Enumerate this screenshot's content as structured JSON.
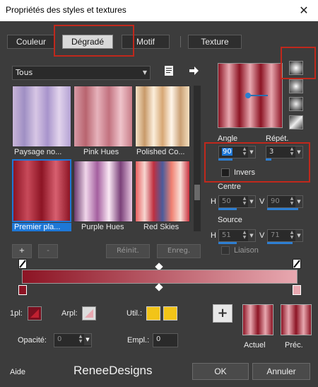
{
  "window": {
    "title": "Propriétés des styles et textures",
    "close_glyph": "✕"
  },
  "tabs": [
    {
      "label": "Couleur"
    },
    {
      "label": "Dégradé"
    },
    {
      "label": "Motif"
    },
    {
      "label": "Texture"
    }
  ],
  "category": {
    "value": "Tous"
  },
  "gradients": [
    {
      "label": "Paysage no...",
      "selected": false
    },
    {
      "label": "Pink Hues",
      "selected": false
    },
    {
      "label": "Polished Co...",
      "selected": false
    },
    {
      "label": "Premier pla...",
      "selected": true
    },
    {
      "label": "Purple Hues",
      "selected": false
    },
    {
      "label": "Red Skies",
      "selected": false
    }
  ],
  "list_buttons": {
    "add": "+",
    "remove": "-",
    "reset": "Réinit.",
    "save": "Enreg."
  },
  "angle": {
    "label": "Angle",
    "value": "90"
  },
  "repeat": {
    "label": "Répét.",
    "value": "3"
  },
  "invert": {
    "label": "Invers",
    "checked": false
  },
  "center": {
    "label": "Centre",
    "h_label": "H",
    "h_value": "50",
    "v_label": "V",
    "v_value": "90"
  },
  "source": {
    "label": "Source",
    "h_label": "H",
    "h_value": "51",
    "v_label": "V",
    "v_value": "71"
  },
  "link": {
    "label": "Liaison",
    "checked": false
  },
  "bottom": {
    "fg_label": "1pl:",
    "bg_label": "Arpl:",
    "util_label": "Util.:",
    "opacity_label": "Opacité:",
    "opacity_value": "0",
    "location_label": "Empl.:",
    "location_value": "0",
    "current_label": "Actuel",
    "previous_label": "Préc.",
    "add_glyph": "+"
  },
  "footer": {
    "help": "Aide",
    "brand": "ReneeDesigns",
    "ok": "OK",
    "cancel": "Annuler"
  },
  "colors": {
    "accent": "#c0281c",
    "selection_blue": "#1e78d7",
    "gradient_dark": "#8c1424",
    "gradient_light": "#e8a8b0",
    "util_yellow": "#f2c418"
  }
}
